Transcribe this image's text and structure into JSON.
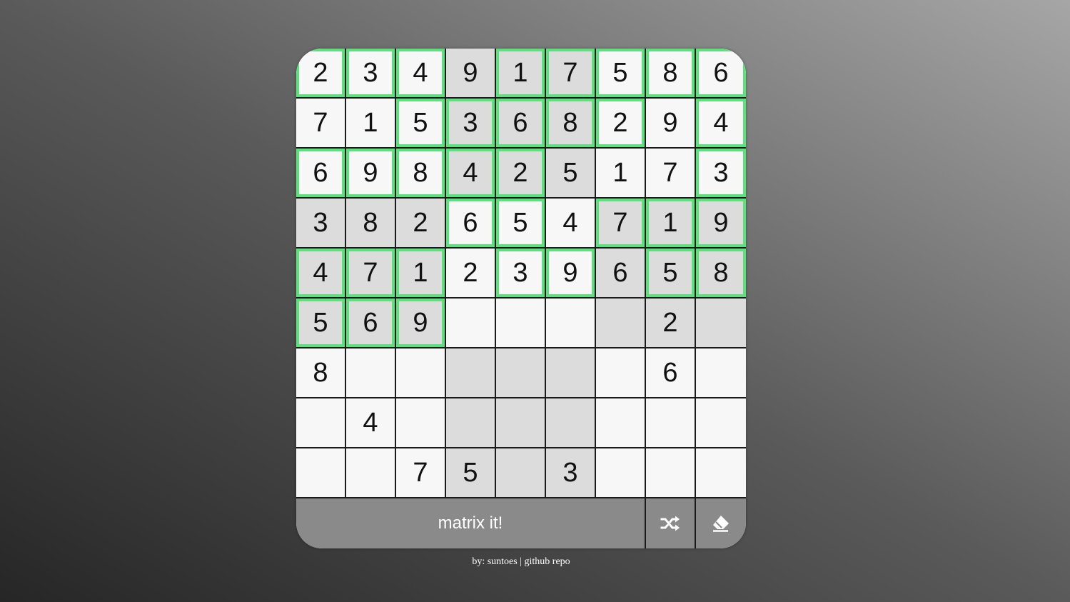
{
  "board": {
    "rows": [
      [
        "2",
        "3",
        "4",
        "9",
        "1",
        "7",
        "5",
        "8",
        "6"
      ],
      [
        "7",
        "1",
        "5",
        "3",
        "6",
        "8",
        "2",
        "9",
        "4"
      ],
      [
        "6",
        "9",
        "8",
        "4",
        "2",
        "5",
        "1",
        "7",
        "3"
      ],
      [
        "3",
        "8",
        "2",
        "6",
        "5",
        "4",
        "7",
        "1",
        "9"
      ],
      [
        "4",
        "7",
        "1",
        "2",
        "3",
        "9",
        "6",
        "5",
        "8"
      ],
      [
        "5",
        "6",
        "9",
        "",
        "",
        "",
        "",
        "2",
        ""
      ],
      [
        "8",
        "",
        "",
        "",
        "",
        "",
        "",
        "6",
        ""
      ],
      [
        "",
        "4",
        "",
        "",
        "",
        "",
        "",
        "",
        ""
      ],
      [
        "",
        "",
        "7",
        "5",
        "",
        "3",
        "",
        "",
        ""
      ]
    ],
    "highlighted": [
      [
        true,
        true,
        true,
        false,
        true,
        true,
        true,
        true,
        true
      ],
      [
        false,
        false,
        true,
        true,
        true,
        true,
        true,
        false,
        true
      ],
      [
        true,
        true,
        true,
        true,
        true,
        false,
        false,
        false,
        true
      ],
      [
        false,
        false,
        false,
        true,
        true,
        false,
        true,
        true,
        true
      ],
      [
        true,
        true,
        true,
        false,
        true,
        true,
        false,
        true,
        true
      ],
      [
        true,
        true,
        true,
        false,
        false,
        false,
        false,
        false,
        false
      ],
      [
        false,
        false,
        false,
        false,
        false,
        false,
        false,
        false,
        false
      ],
      [
        false,
        false,
        false,
        false,
        false,
        false,
        false,
        false,
        false
      ],
      [
        false,
        false,
        false,
        false,
        false,
        false,
        false,
        false,
        false
      ]
    ]
  },
  "controls": {
    "matrix_label": "matrix it!",
    "shuffle_icon": "shuffle-icon",
    "eraser_icon": "eraser-icon"
  },
  "footer": {
    "by_text": "by: suntoes",
    "separator": " | ",
    "repo_link": "github repo"
  },
  "colors": {
    "highlight": "#5fe07e",
    "shaded_cell": "#dcdcdc",
    "light_cell": "#f7f7f7",
    "control_bar": "#8a8a8a"
  }
}
